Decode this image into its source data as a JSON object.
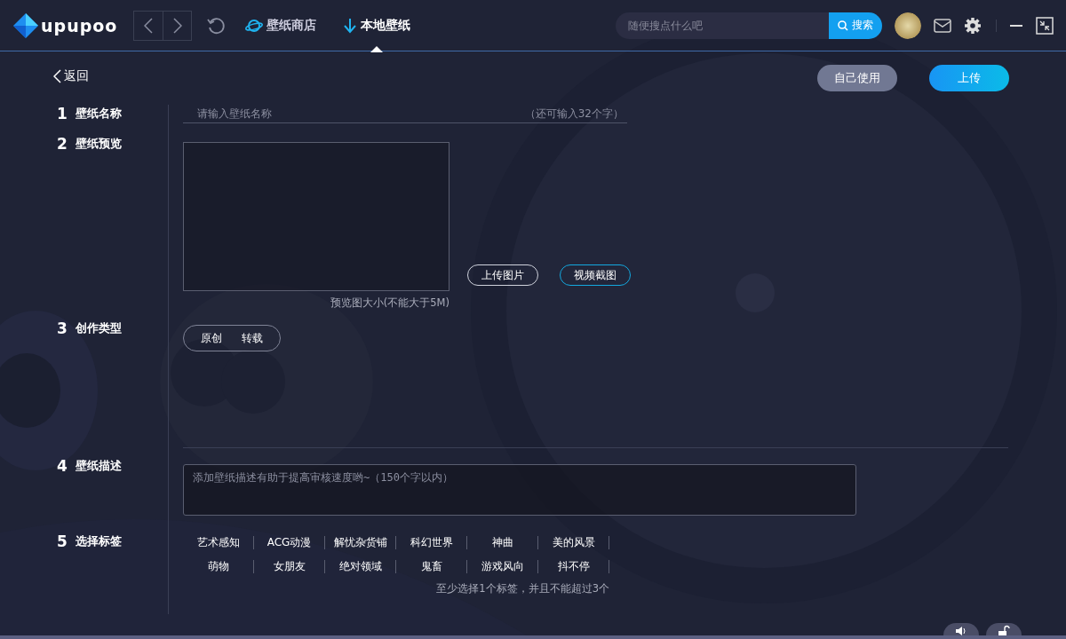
{
  "app": {
    "logo_text": "upupoo"
  },
  "nav": [
    {
      "label": "壁纸商店",
      "kind": "store",
      "selected": false
    },
    {
      "label": "本地壁纸",
      "kind": "local",
      "selected": true
    }
  ],
  "search": {
    "placeholder": "随便搜点什么吧",
    "button": "搜索"
  },
  "back": "返回",
  "actions": [
    {
      "label": "自己使用",
      "kind": "secondary"
    },
    {
      "label": "上传",
      "kind": "primary"
    }
  ],
  "sections": [
    {
      "number": "1",
      "label": "壁纸名称"
    },
    {
      "number": "2",
      "label": "壁纸预览"
    },
    {
      "number": "3",
      "label": "创作类型"
    },
    {
      "number": "4",
      "label": "壁纸描述"
    },
    {
      "number": "5",
      "label": "选择标签"
    }
  ],
  "name_field": {
    "placeholder": "请输入壁纸名称",
    "counter": "（还可输入32个字）"
  },
  "preview": {
    "buttons": [
      {
        "label": "上传图片",
        "kind": "plain"
      },
      {
        "label": "视频截图",
        "kind": "accent"
      }
    ],
    "caption": "预览图大小(不能大于5M)"
  },
  "creation_types": [
    {
      "label": "原创"
    },
    {
      "label": "转载"
    }
  ],
  "description": {
    "placeholder": "添加壁纸描述有助于提高审核速度哟~（150个字以内）"
  },
  "tags": [
    {
      "label": "艺术感知",
      "selected": false
    },
    {
      "label": "ACG动漫",
      "selected": false
    },
    {
      "label": "解忧杂货铺",
      "selected": false
    },
    {
      "label": "科幻世界",
      "selected": false
    },
    {
      "label": "神曲",
      "selected": false
    },
    {
      "label": "美的风景",
      "selected": false
    },
    {
      "label": "萌物",
      "selected": false
    },
    {
      "label": "女朋友",
      "selected": false
    },
    {
      "label": "绝对领域",
      "selected": false
    },
    {
      "label": "鬼畜",
      "selected": false
    },
    {
      "label": "游戏风向",
      "selected": false
    },
    {
      "label": "抖不停",
      "selected": false
    }
  ],
  "tags_hint": "至少选择1个标签，并且不能超过3个"
}
